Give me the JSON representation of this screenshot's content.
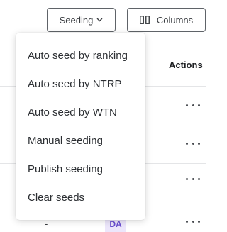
{
  "toolbar": {
    "seeding_label": "Seeding",
    "columns_label": "Columns"
  },
  "table": {
    "actions_header": "Actions",
    "visible_cells": {
      "dash": "-",
      "badge": "DA"
    }
  },
  "seeding_menu": {
    "items": [
      {
        "label": "Auto seed by ranking"
      },
      {
        "label": "Auto seed by NTRP"
      },
      {
        "label": "Auto seed by WTN"
      },
      {
        "label": "Manual seeding"
      },
      {
        "label": "Publish seeding"
      },
      {
        "label": "Clear seeds"
      }
    ]
  },
  "colors": {
    "badge_bg": "#ece6fb",
    "badge_text": "#6a4fd0",
    "border": "#5f6368"
  },
  "icons": {
    "seeding_chevron": "chevron-down-icon",
    "columns": "columns-icon",
    "row_actions": "more-horizontal-icon"
  }
}
